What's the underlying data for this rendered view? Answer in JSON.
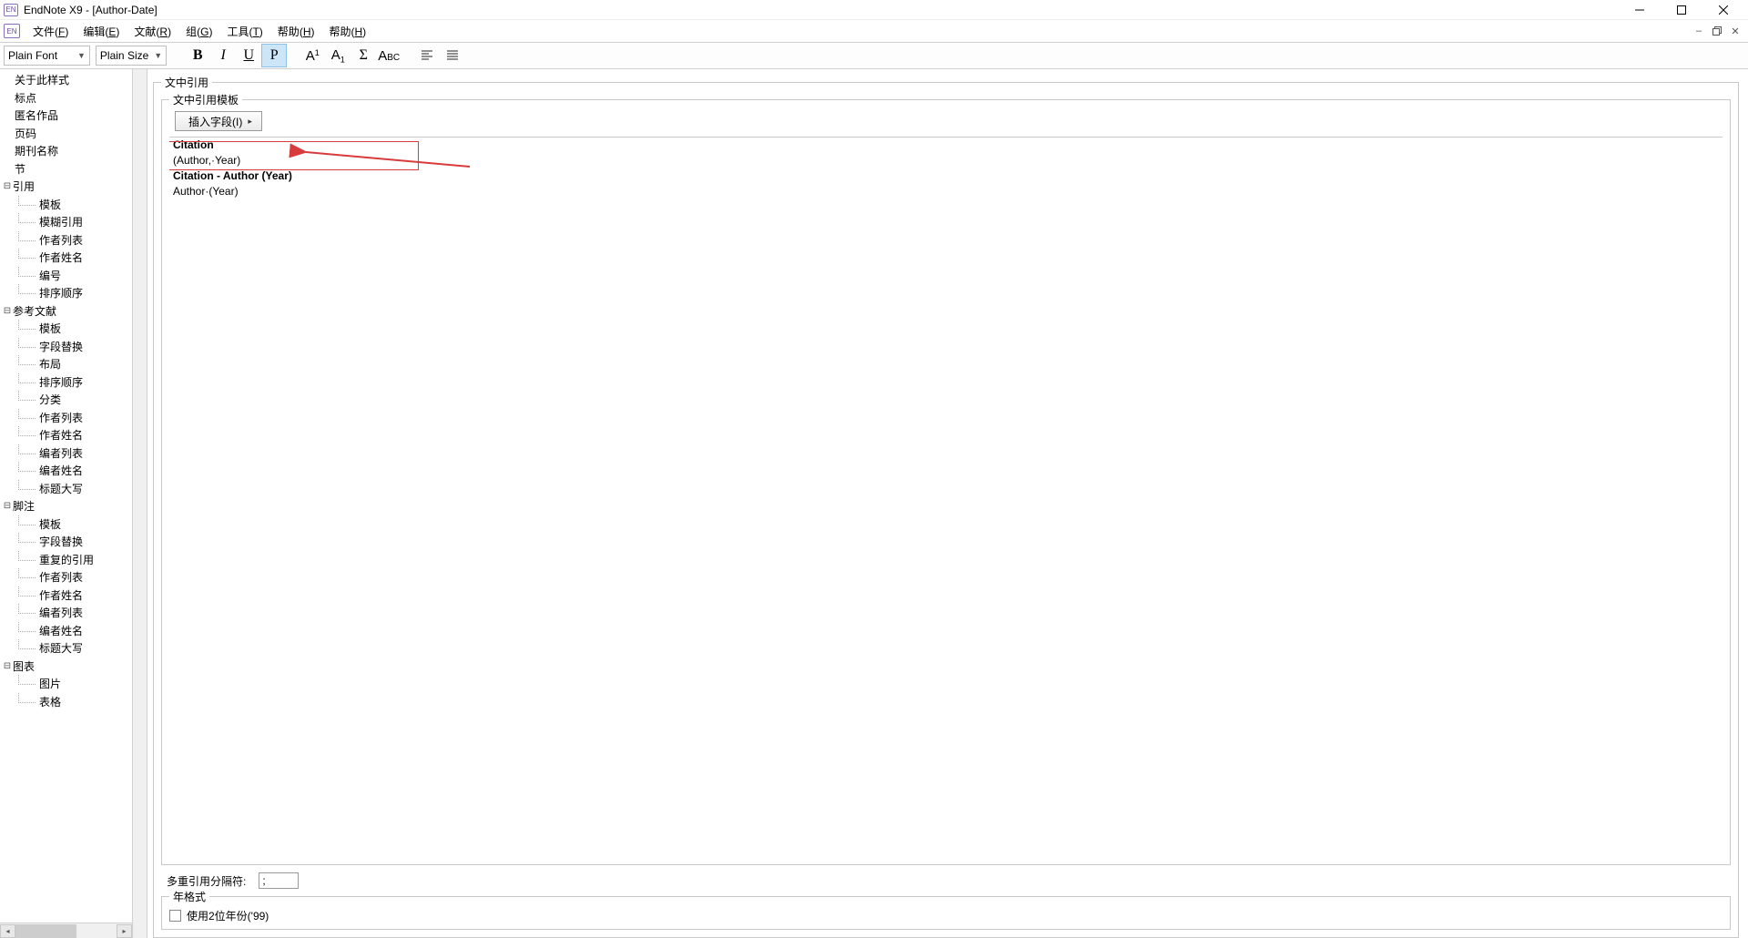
{
  "window": {
    "title": "EndNote X9 - [Author-Date]",
    "app_icon_label": "EN"
  },
  "menu": {
    "items": [
      {
        "label": "文件",
        "accel": "F"
      },
      {
        "label": "编辑",
        "accel": "E"
      },
      {
        "label": "文献",
        "accel": "R"
      },
      {
        "label": "组",
        "accel": "G"
      },
      {
        "label": "工具",
        "accel": "T"
      },
      {
        "label": "帮助",
        "accel": "H"
      },
      {
        "label": "帮助",
        "accel": "H"
      }
    ]
  },
  "toolbar": {
    "font_combo": "Plain Font",
    "size_combo": "Plain Size",
    "buttons": {
      "bold": "B",
      "italic": "I",
      "underline": "U",
      "plain": "P",
      "superscript": {
        "big": "A",
        "sm": "1"
      },
      "subscript": {
        "big": "A",
        "sm": "1"
      },
      "sigma": "Σ",
      "smallcaps": {
        "cap": "A",
        "low": "BC"
      }
    }
  },
  "tree": [
    {
      "depth": 1,
      "label": "关于此样式"
    },
    {
      "depth": 1,
      "label": "标点"
    },
    {
      "depth": 1,
      "label": "匿名作品"
    },
    {
      "depth": 1,
      "label": "页码"
    },
    {
      "depth": 1,
      "label": "期刊名称"
    },
    {
      "depth": 1,
      "label": "节"
    },
    {
      "depth": 1,
      "label": "引用",
      "exp": "⊟"
    },
    {
      "depth": 2,
      "label": "模板"
    },
    {
      "depth": 2,
      "label": "模糊引用"
    },
    {
      "depth": 2,
      "label": "作者列表"
    },
    {
      "depth": 2,
      "label": "作者姓名"
    },
    {
      "depth": 2,
      "label": "编号"
    },
    {
      "depth": 2,
      "label": "排序顺序"
    },
    {
      "depth": 1,
      "label": "参考文献",
      "exp": "⊟"
    },
    {
      "depth": 2,
      "label": "模板"
    },
    {
      "depth": 2,
      "label": "字段替换"
    },
    {
      "depth": 2,
      "label": "布局"
    },
    {
      "depth": 2,
      "label": "排序顺序"
    },
    {
      "depth": 2,
      "label": "分类"
    },
    {
      "depth": 2,
      "label": "作者列表"
    },
    {
      "depth": 2,
      "label": "作者姓名"
    },
    {
      "depth": 2,
      "label": "编者列表"
    },
    {
      "depth": 2,
      "label": "编者姓名"
    },
    {
      "depth": 2,
      "label": "标题大写"
    },
    {
      "depth": 1,
      "label": "脚注",
      "exp": "⊟"
    },
    {
      "depth": 2,
      "label": "模板"
    },
    {
      "depth": 2,
      "label": "字段替换"
    },
    {
      "depth": 2,
      "label": "重复的引用"
    },
    {
      "depth": 2,
      "label": "作者列表"
    },
    {
      "depth": 2,
      "label": "作者姓名"
    },
    {
      "depth": 2,
      "label": "编者列表"
    },
    {
      "depth": 2,
      "label": "编者姓名"
    },
    {
      "depth": 2,
      "label": "标题大写"
    },
    {
      "depth": 1,
      "label": "图表",
      "exp": "⊟"
    },
    {
      "depth": 2,
      "label": "图片"
    },
    {
      "depth": 2,
      "label": "表格"
    }
  ],
  "main": {
    "outer_legend": "文中引用",
    "template_legend": "文中引用模板",
    "insert_field_label": "插入字段(I)",
    "citation_rows": [
      {
        "title": "Citation",
        "body": "(Author,·Year)"
      },
      {
        "title": "Citation - Author (Year)",
        "body": "Author·(Year)"
      }
    ],
    "separator_label": "多重引用分隔符:",
    "separator_value": ";",
    "year_legend": "年格式",
    "year_checkbox_label": "使用2位年份('99)"
  }
}
